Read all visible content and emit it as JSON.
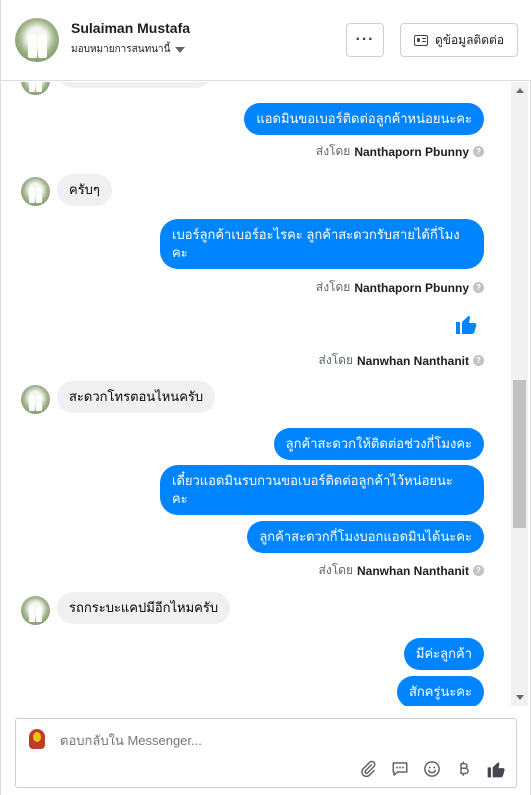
{
  "header": {
    "name": "Sulaiman Mustafa",
    "assign_label": "มอบหมายการสนทนานี้",
    "more_label": "···",
    "view_contact_label": "ดูข้อมูลติดต่อ"
  },
  "messages": {
    "m1": "แอดมินขอเบอร์ติดต่อลูกค้าหน่อยนะคะ",
    "s1_prefix": "ส่งโดย",
    "s1_name": "Nanthaporn Pbunny",
    "m2": "ครับๆ",
    "m3_line1": "เบอร์ลูกค้าเบอร์อะไรคะ ลูกค้าสะดวกรับสายได้กี่โมง",
    "m3_line2": "คะ",
    "s2_prefix": "ส่งโดย",
    "s2_name": "Nanthaporn Pbunny",
    "s3_prefix": "ส่งโดย",
    "s3_name": "Nanwhan Nanthanit",
    "m4": "สะดวกโทรตอนไหนครับ",
    "m5": "ลูกค้าสะดวกให้ติดต่อช่วงกี่โมงคะ",
    "m6_line1": "เดี๋ยวแอดมินรบกวนขอเบอร์ติดต่อลูกค้าไว้หน่อยนะ",
    "m6_line2": "คะ",
    "m7": "ลูกค้าสะดวกกี่โมงบอกแอดมินได้นะคะ",
    "s4_prefix": "ส่งโดย",
    "s4_name": "Nanwhan Nanthanit",
    "m8": "รถกระบะแคปมีอีกไหมครับ",
    "m9": "มีค่ะลูกค้า",
    "m10": "สักครู่นะคะ"
  },
  "composer": {
    "placeholder": "ตอบกลับใน Messenger..."
  },
  "icons": {
    "attach": "paperclip-icon",
    "saved_replies": "speech-bubble-icon",
    "emoji": "smiley-icon",
    "payment": "baht-icon",
    "like": "thumbs-up-icon"
  },
  "colors": {
    "outgoing_bubble": "#0084ff",
    "incoming_bubble": "#f0f0f0"
  }
}
